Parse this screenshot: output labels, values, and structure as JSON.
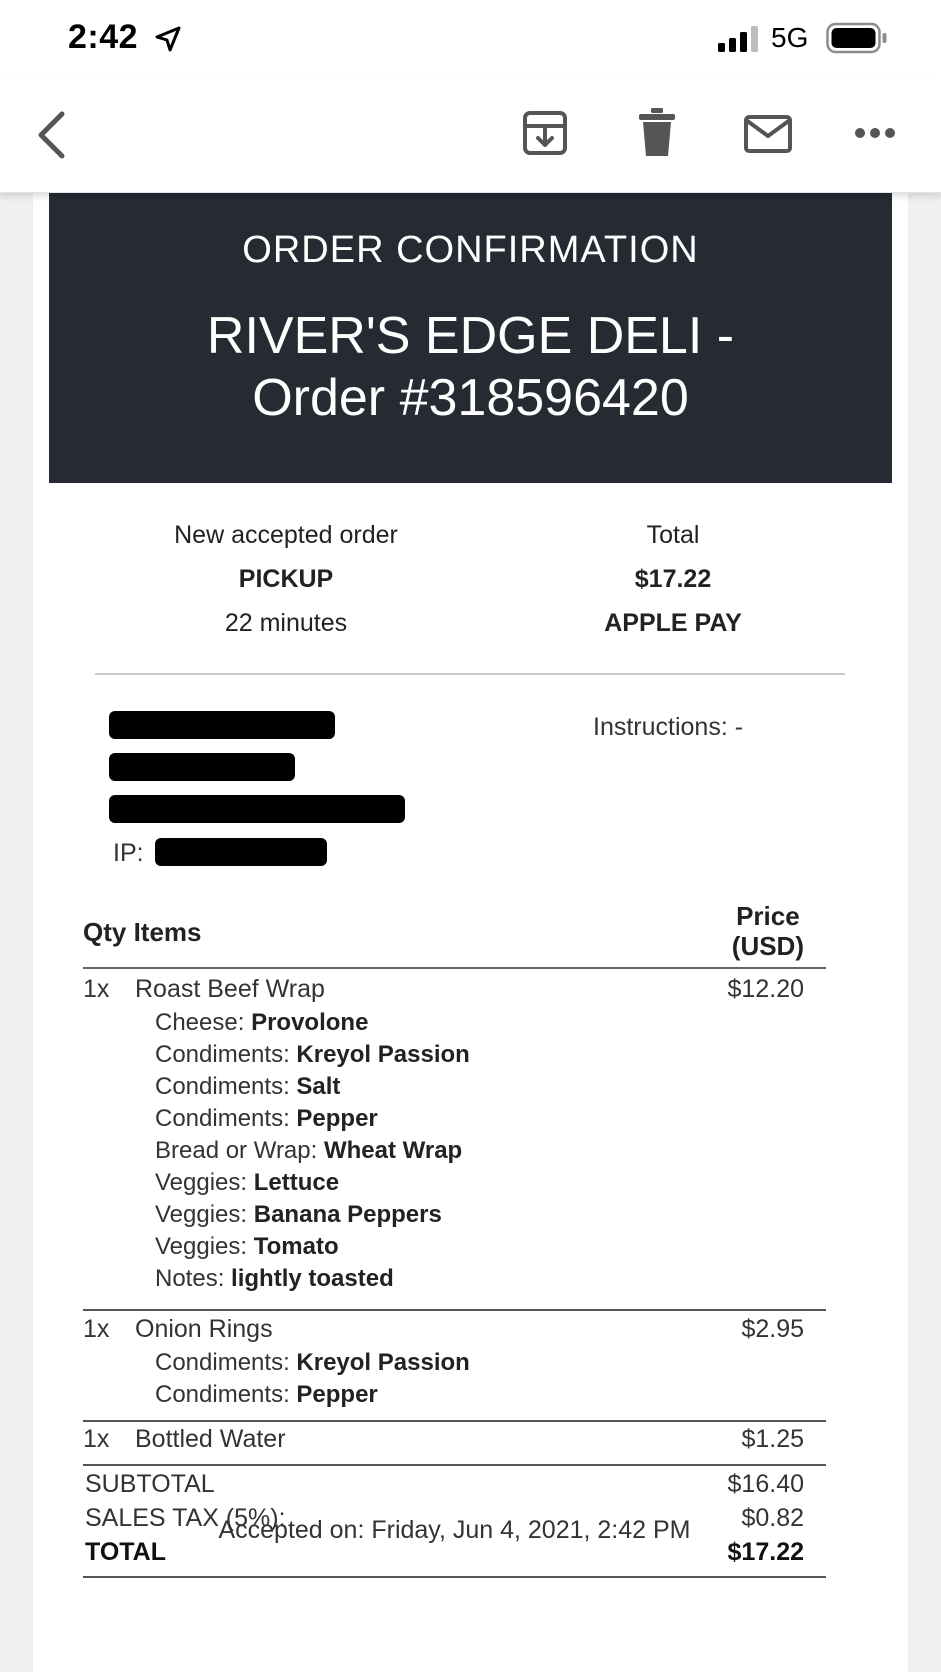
{
  "status_bar": {
    "time": "2:42",
    "network": "5G",
    "icons": [
      "location-arrow-icon",
      "signal-bars-icon",
      "battery-icon"
    ]
  },
  "toolbar": {
    "icons": [
      "back-chevron-icon",
      "archive-icon",
      "trash-icon",
      "mail-icon",
      "more-dots-icon"
    ]
  },
  "header": {
    "kicker": "ORDER CONFIRMATION",
    "title_line1": "RIVER'S EDGE DELI -",
    "title_line2": "Order #318596420",
    "background_color": "#262b33"
  },
  "summary": {
    "status_label": "New accepted order",
    "fulfillment": "PICKUP",
    "eta": "22 minutes",
    "total_label": "Total",
    "total_value": "$17.22",
    "payment_method": "APPLE PAY"
  },
  "customer": {
    "instructions": "Instructions: -",
    "ip_label": "IP:"
  },
  "table": {
    "head_left": "Qty Items",
    "head_price_line1": "Price",
    "head_price_line2": "(USD)"
  },
  "items": [
    {
      "qty": "1x",
      "name": "Roast Beef Wrap",
      "price": "$12.20",
      "modifiers": [
        {
          "label": "Cheese:",
          "value": "Provolone"
        },
        {
          "label": "Condiments:",
          "value": "Kreyol Passion"
        },
        {
          "label": "Condiments:",
          "value": "Salt"
        },
        {
          "label": "Condiments:",
          "value": "Pepper"
        },
        {
          "label": "Bread or Wrap:",
          "value": "Wheat Wrap"
        },
        {
          "label": "Veggies:",
          "value": "Lettuce"
        },
        {
          "label": "Veggies:",
          "value": "Banana Peppers"
        },
        {
          "label": "Veggies:",
          "value": "Tomato"
        },
        {
          "label": "Notes:",
          "value": "lightly toasted"
        }
      ]
    },
    {
      "qty": "1x",
      "name": "Onion Rings",
      "price": "$2.95",
      "modifiers": [
        {
          "label": "Condiments:",
          "value": "Kreyol Passion"
        },
        {
          "label": "Condiments:",
          "value": "Pepper"
        }
      ]
    },
    {
      "qty": "1x",
      "name": "Bottled Water",
      "price": "$1.25",
      "modifiers": []
    }
  ],
  "totals": {
    "subtotal_label": "SUBTOTAL",
    "subtotal_value": "$16.40",
    "tax_label": "SALES TAX (5%):",
    "tax_value": "$0.82",
    "total_label": "TOTAL",
    "total_value": "$17.22"
  },
  "footer": {
    "accepted_on": "Accepted on: Friday, Jun 4, 2021, 2:42 PM"
  }
}
